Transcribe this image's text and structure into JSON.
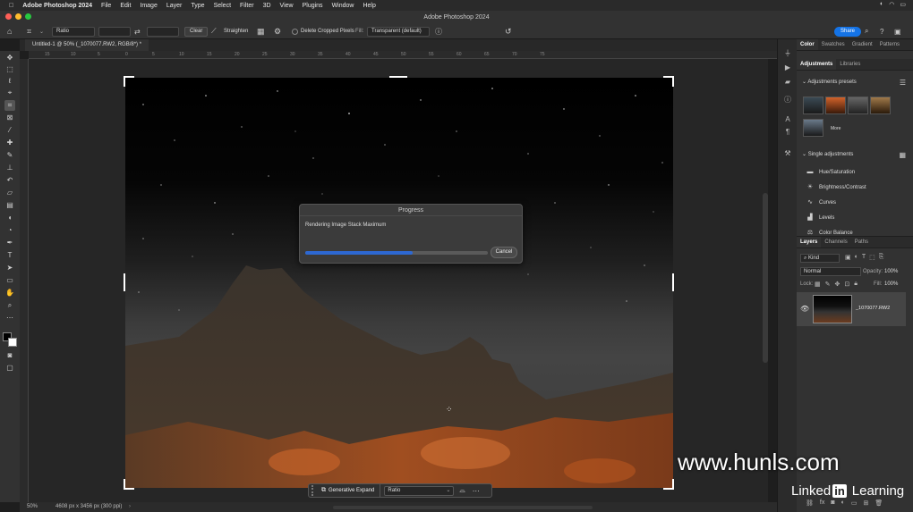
{
  "menubar": {
    "app_name": "Adobe Photoshop 2024",
    "items": [
      "File",
      "Edit",
      "Image",
      "Layer",
      "Type",
      "Select",
      "Filter",
      "3D",
      "View",
      "Plugins",
      "Window",
      "Help"
    ]
  },
  "titlebar": {
    "title": "Adobe Photoshop 2024"
  },
  "options": {
    "ratio_select": "Ratio",
    "clear_label": "Clear",
    "straighten_label": "Straighten",
    "delete_cropped_label": "Delete Cropped Pixels",
    "fill_label": "Fill:",
    "fill_value": "Transparent (default)",
    "share_label": "Share"
  },
  "document": {
    "tab_title": "Untitled-1 @ 50% (_1070077.RW2, RGB/8*) *",
    "zoom": "50%",
    "doc_info": "4608 px x 3456 px (300 ppi)"
  },
  "ruler_ticks": [
    "15",
    "10",
    "5",
    "0",
    "5",
    "10",
    "15",
    "20",
    "25",
    "30",
    "35",
    "40",
    "45",
    "50",
    "55",
    "60",
    "65",
    "70",
    "75"
  ],
  "progress": {
    "title": "Progress",
    "message": "Rendering Image Stack Maximum",
    "percent": 59,
    "cancel_label": "Cancel"
  },
  "taskbar": {
    "generative_expand_label": "Generative Expand",
    "ratio_value": "Ratio"
  },
  "panels": {
    "color_tabs": [
      "Color",
      "Swatches",
      "Gradient",
      "Patterns"
    ],
    "adjust_tabs": [
      "Adjustments",
      "Libraries"
    ],
    "presets_header": "Adjustments presets",
    "more_label": "More",
    "single_header": "Single adjustments",
    "single_items": [
      "Hue/Saturation",
      "Brightness/Contrast",
      "Curves",
      "Levels",
      "Color Balance"
    ],
    "layer_tabs": [
      "Layers",
      "Channels",
      "Paths"
    ],
    "kind_label": "Kind",
    "blend_mode": "Normal",
    "opacity_label": "Opacity:",
    "opacity_value": "100%",
    "lock_label": "Lock:",
    "fill_label": "Fill:",
    "fill_value": "100%",
    "layer_name": "_1070077.RW2"
  },
  "watermark": {
    "text": "www.hunls.com",
    "brand": "Linked",
    "brand_in": "in",
    "brand_tail": "Learning"
  },
  "colors": {
    "accent": "#1473e6",
    "progress_fill": "#2d68d2",
    "ember": "#b0521e"
  }
}
